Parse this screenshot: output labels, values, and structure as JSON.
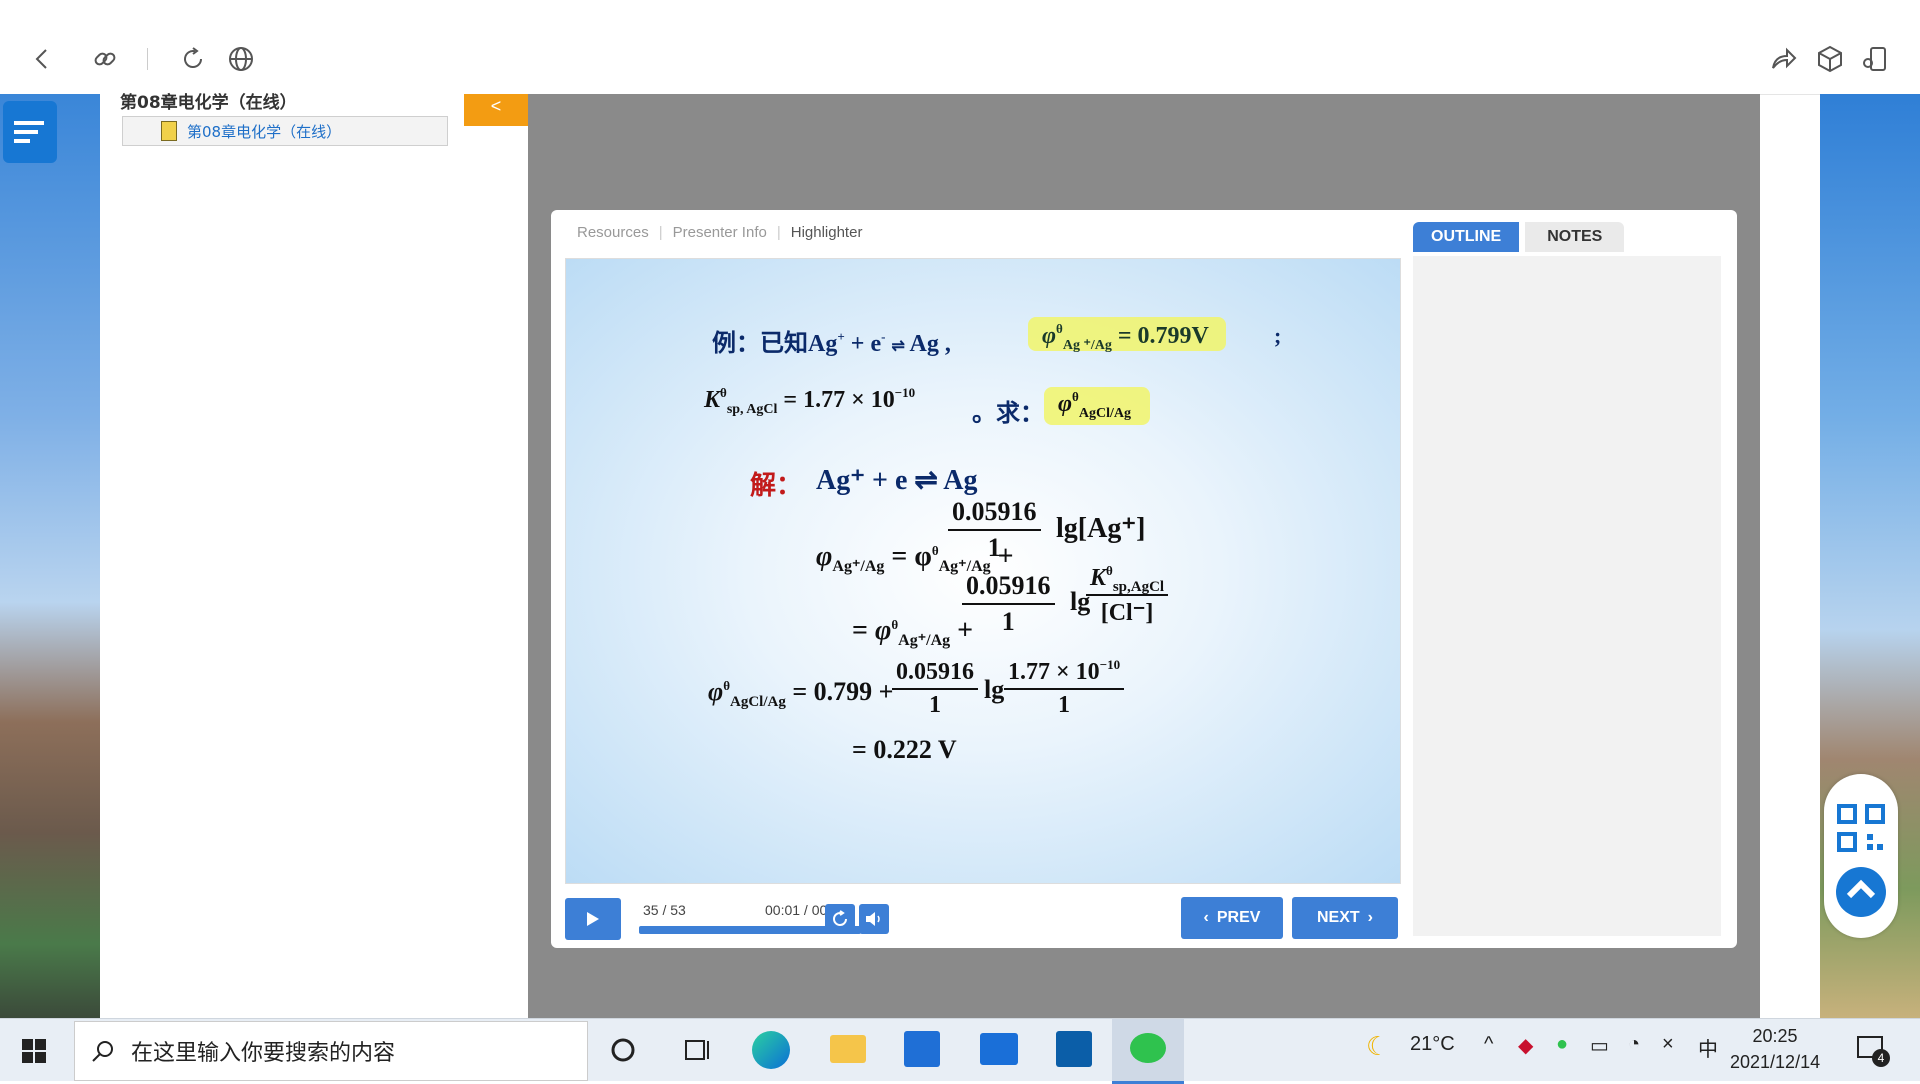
{
  "window": {
    "minimize": "—",
    "restore": "⧉",
    "close": "✕"
  },
  "toolbar": {
    "back": "back-icon",
    "link": "link-icon",
    "refresh": "refresh-icon",
    "globe": "globe-icon",
    "share": "share-icon",
    "cube": "cube-icon",
    "user": "user-icon"
  },
  "course": {
    "title": "第08章电化学（在线）",
    "item_label": "第08章电化学（在线）"
  },
  "collapse_label": "<",
  "player": {
    "links": [
      "Resources",
      "Presenter Info",
      "Highlighter"
    ],
    "slide_counter": "35 / 53",
    "time": "00:01 / 00:01",
    "prev_label": "PREV",
    "next_label": "NEXT",
    "progress": 1.0,
    "tabs": {
      "outline": "OUTLINE",
      "notes": "NOTES"
    }
  },
  "slide": {
    "line1_a": "例：已知Ag",
    "line1_b": "+  e",
    "line1_c": "Ag ,",
    "line1_phi": "φ",
    "line1_sub": "Ag ⁺/Ag",
    "line1_val": "= 0.799V",
    "line1_end": ";",
    "line2_k": "K",
    "line2_ksub": "sp, AgCl",
    "line2_val": "= 1.77 × 10",
    "line2_exp": "−10",
    "line2_ask": "。求：",
    "line2_sub": "AgCl/Ag",
    "sol_label": "解：",
    "sol_eq": "Ag⁺ + e ⇌  Ag",
    "eq1_lhs": "φ",
    "eq1_lsub": "Ag⁺/Ag",
    "eq1_mid": "= φ",
    "eq1_msub": "Ag⁺/Ag",
    "frac_num": "0.05916",
    "frac_den": "1",
    "eq1_tail": "lg[Ag⁺]",
    "eq2_k": "K",
    "eq2_ksub": "sp,AgCl",
    "eq2_cl": "[Cl⁻]",
    "eq3_val": "= 0.799  +",
    "eq3_num2": "1.77 × 10",
    "eq3_exp": "−10",
    "result": "= 0.222 V",
    "lg": "lg",
    "theta": "θ"
  },
  "taskbar": {
    "search_placeholder": "在这里输入你要搜索的内容",
    "weather": "21°C",
    "ime": "中",
    "time": "20:25",
    "date": "2021/12/14",
    "notifications": "4"
  }
}
